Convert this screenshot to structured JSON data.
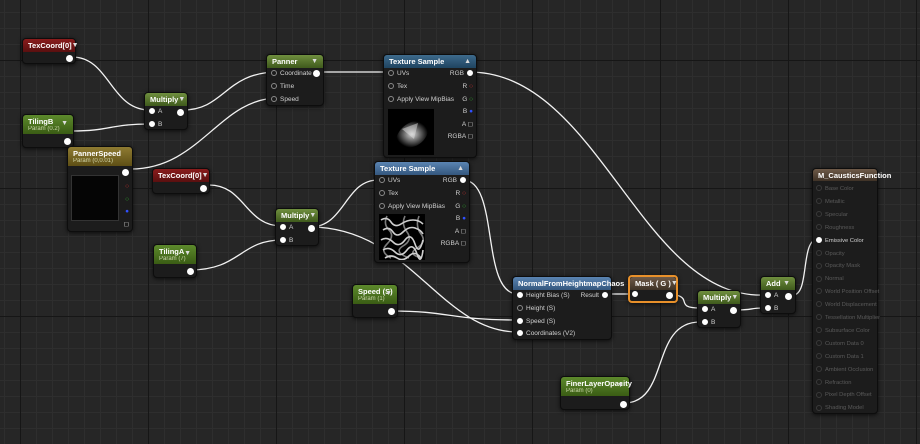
{
  "nodes": {
    "texcoord_1": {
      "title": "TexCoord[0]"
    },
    "texcoord_2": {
      "title": "TexCoord[0]"
    },
    "tilingB": {
      "title": "TilingB",
      "sub": "Param (0.2)"
    },
    "panner_speed": {
      "title": "PannerSpeed",
      "sub": "Param (0,0.01)"
    },
    "multiply_1": {
      "title": "Multiply",
      "a": "A",
      "b": "B"
    },
    "panner": {
      "title": "Panner",
      "coordinate": "Coordinate",
      "time": "Time",
      "speed": "Speed"
    },
    "texsample_1": {
      "title": "Texture Sample",
      "uvs": "UVs",
      "tex": "Tex",
      "mip": "Apply View MipBias",
      "rgb": "RGB",
      "r": "R",
      "g": "G",
      "b": "B",
      "a": "A",
      "rgba": "RGBA"
    },
    "texsample_2": {
      "title": "Texture Sample",
      "uvs": "UVs",
      "tex": "Tex",
      "mip": "Apply View MipBias",
      "rgb": "RGB",
      "r": "R",
      "g": "G",
      "b": "B",
      "a": "A",
      "rgba": "RGBA"
    },
    "multiply_2": {
      "title": "Multiply",
      "a": "A",
      "b": "B"
    },
    "tilingA": {
      "title": "TilingA",
      "sub": "Param (7)"
    },
    "speed": {
      "title": "Speed (S)",
      "sub": "Param (1)"
    },
    "normal": {
      "title": "NormalFromHeightmapChaos",
      "height_bias": "Height Bias (S)",
      "height": "Height (S)",
      "speed": "Speed (S)",
      "coords": "Coordinates (V2)",
      "result": "Result"
    },
    "mask": {
      "title": "Mask ( G )"
    },
    "multiply_3": {
      "title": "Multiply",
      "a": "A",
      "b": "B"
    },
    "add": {
      "title": "Add",
      "a": "A",
      "b": "B"
    },
    "finer": {
      "title": "FinerLayerOpacity",
      "sub": "Param (0)"
    },
    "result": {
      "title": "M_CausticsFunction",
      "pins": [
        "Base Color",
        "Metallic",
        "Specular",
        "Roughness",
        "Emissive Color",
        "Opacity",
        "Opacity Mask",
        "Normal",
        "World Position Offset",
        "World Displacement",
        "Tessellation Multiplier",
        "Subsurface Color",
        "Custom Data 0",
        "Custom Data 1",
        "Ambient Occlusion",
        "Refraction",
        "Pixel Depth Offset",
        "Shading Model"
      ],
      "active_pin": "Emissive Color"
    }
  },
  "colors": {
    "mask_border": "#e8902a",
    "wire": "#ffffff",
    "r": "#e03030",
    "g": "#30c030",
    "b": "#3050ff"
  }
}
